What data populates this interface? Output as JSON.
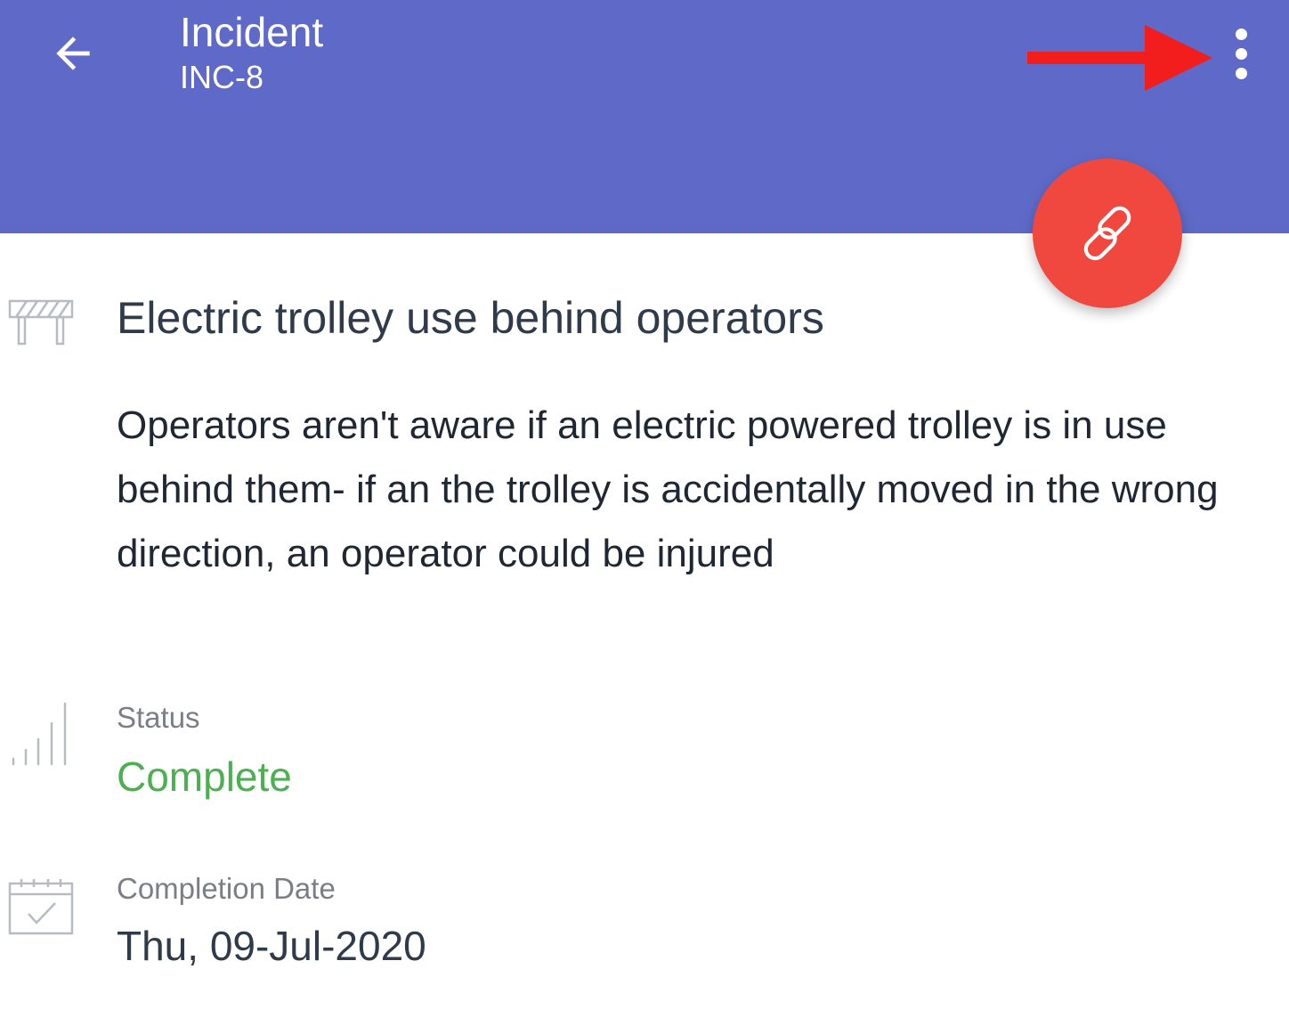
{
  "appbar": {
    "title": "Incident",
    "subtitle": "INC-8",
    "back_icon": "arrow-left-icon",
    "more_icon": "more-vertical-icon",
    "background_color": "#5F6AC8"
  },
  "fab": {
    "icon": "link-icon",
    "color": "#F0473F"
  },
  "annotation": {
    "icon": "red-arrow",
    "color": "#F21D1D"
  },
  "incident": {
    "icon": "barrier-icon",
    "title": "Electric trolley use behind operators",
    "description": "Operators aren't aware if an electric powered trolley is in use behind them- if an the trolley is accidentally moved in the wrong direction, an operator could be injured"
  },
  "status": {
    "icon": "signal-bars-icon",
    "label": "Status",
    "value": "Complete",
    "value_color": "#4CAF50"
  },
  "completion": {
    "icon": "calendar-check-icon",
    "label": "Completion Date",
    "value": "Thu, 09-Jul-2020"
  }
}
